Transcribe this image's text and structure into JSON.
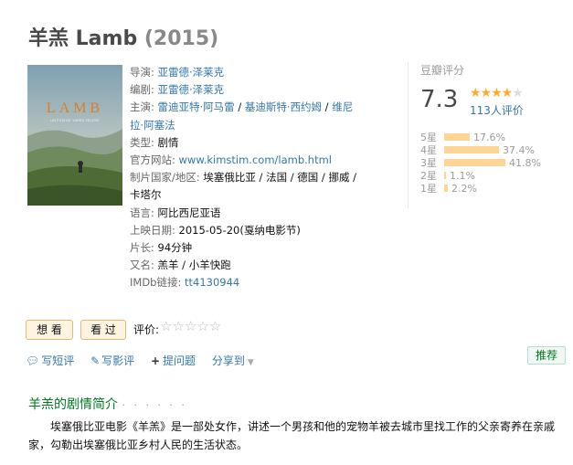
{
  "header": {
    "title": "羊羔 Lamb",
    "year": "(2015)"
  },
  "poster": {
    "title_text": "LAMB",
    "subtitle_text": "UN FILM DE YARED ZELEKE"
  },
  "info": {
    "director_label": "导演:",
    "director": "亚雷德·泽莱克",
    "writer_label": "编剧:",
    "writer": "亚雷德·泽莱克",
    "cast_label": "主演:",
    "cast_1": "雷迪亚特·阿马雷",
    "sep1": " / ",
    "cast_2": "基迪斯特·西约姆",
    "sep2": " / ",
    "cast_3a": "维尼",
    "cast_3b": "拉·阿塞法",
    "genre_label": "类型:",
    "genre": "剧情",
    "site_label": "官方网站:",
    "site": "www.kimstim.com/lamb.html",
    "country_label": "制片国家/地区:",
    "country_a": "埃塞俄比亚 / 法国 / 德国 / 挪威 /",
    "country_b": "卡塔尔",
    "lang_label": "语言:",
    "lang": "阿比西尼亚语",
    "release_label": "上映日期:",
    "release": "2015-05-20(戛纳电影节)",
    "runtime_label": "片长:",
    "runtime": "94分钟",
    "aka_label": "又名:",
    "aka": "羔羊 / 小羊快跑",
    "imdb_label": "IMDb链接:",
    "imdb": "tt4130944"
  },
  "rating": {
    "label": "豆瓣评分",
    "score": "7.3",
    "stars": "★★★★",
    "star_empty": "★",
    "count": "113人评价",
    "star_level": 3.5,
    "bars": [
      {
        "star": "5星",
        "pct": "17.6%",
        "value": 17.6
      },
      {
        "star": "4星",
        "pct": "37.4%",
        "value": 37.4
      },
      {
        "star": "3星",
        "pct": "41.8%",
        "value": 41.8
      },
      {
        "star": "2星",
        "pct": "1.1%",
        "value": 1.1
      },
      {
        "star": "1星",
        "pct": "2.2%",
        "value": 2.2
      }
    ]
  },
  "actions": {
    "want": "想 看",
    "seen": "看 过",
    "rate_label": "评价:",
    "rate_stars": "☆☆☆☆☆",
    "short_review": "写短评",
    "review": "写影评",
    "question": "提问题",
    "share": "分享到",
    "recommend": "推荐"
  },
  "synopsis": {
    "title": "羊羔的剧情简介",
    "dots": "· · · · · ·",
    "text": "埃塞俄比亚电影《羊羔》是一部处女作，讲述一个男孩和他的宠物羊被去城市里找工作的父亲寄养在亲戚家，勾勒出埃塞俄比亚乡村人民的生活状态。"
  }
}
